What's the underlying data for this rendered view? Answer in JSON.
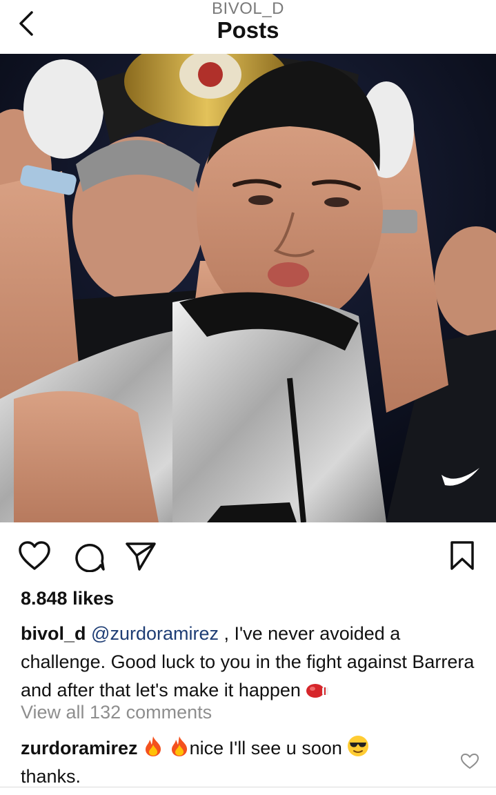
{
  "header": {
    "username": "BIVOL_D",
    "title": "Posts"
  },
  "post": {
    "likes": "8.848 likes",
    "caption": {
      "username": "bivol_d",
      "mention": "@zurdoramirez",
      "text_part1": " , I've never avoided a challenge. Good luck to you in the fight against Barrera and after that let's make it happen "
    },
    "view_comments": "View all 132 comments",
    "comment": {
      "username": "zurdoramirez",
      "text_part1": "nice I'll see u soon ",
      "text_part2": "thanks."
    }
  },
  "icons": {
    "back": "chevron-left-icon",
    "like": "heart-icon",
    "comment": "speech-bubble-icon",
    "share": "paper-plane-icon",
    "save": "bookmark-icon",
    "fire": "fire-emoji",
    "glove": "boxing-glove-emoji",
    "sunglasses": "sunglasses-emoji"
  }
}
